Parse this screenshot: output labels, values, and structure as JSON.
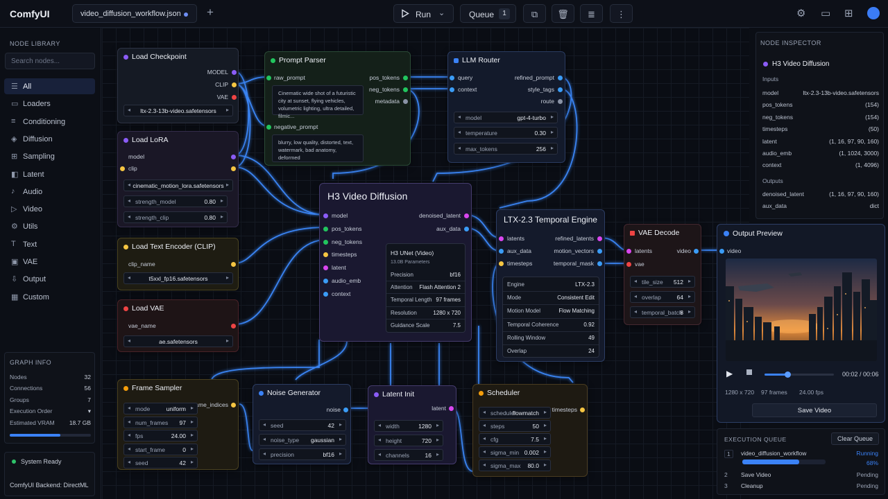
{
  "app": {
    "name": "ComfyUI",
    "file_tab": "video_diffusion_workflow.json"
  },
  "toolbar": {
    "run_label": "Run",
    "queue_label": "Queue",
    "queue_count": "1"
  },
  "sidebar": {
    "heading": "NODE LIBRARY",
    "search_placeholder": "Search nodes...",
    "categories": [
      "All",
      "Loaders",
      "Conditioning",
      "Diffusion",
      "Sampling",
      "Latent",
      "Audio",
      "Video",
      "Utils",
      "Text",
      "VAE",
      "Output",
      "Custom"
    ],
    "graph_info": {
      "heading": "GRAPH INFO",
      "rows": [
        {
          "k": "Nodes",
          "v": "32"
        },
        {
          "k": "Connections",
          "v": "56"
        },
        {
          "k": "Groups",
          "v": "7"
        },
        {
          "k": "Execution Order",
          "v": "▾"
        },
        {
          "k": "Estimated VRAM",
          "v": "18.7 GB"
        }
      ],
      "vram_fraction": 0.62
    },
    "status": "System Ready",
    "backend": "ComfyUI Backend: DirectML"
  },
  "nodes": {
    "load_checkpoint": {
      "title": "Load Checkpoint",
      "outputs": [
        "MODEL",
        "CLIP",
        "VAE"
      ],
      "file": "ltx-2.3-13b-video.safetensors"
    },
    "prompt_parser": {
      "title": "Prompt Parser",
      "raw_label": "raw_prompt",
      "raw_text": "Cinematic wide shot of a futuristic city at sunset, flying vehicles, volumetric lighting, ultra detailed, filmic...",
      "neg_label": "negative_prompt",
      "neg_text": "blurry, low quality, distorted, text, watermark, bad anatomy, deformed",
      "outputs": [
        "pos_tokens",
        "neg_tokens",
        "metadata"
      ]
    },
    "llm_router": {
      "title": "LLM Router",
      "inputs": [
        "query",
        "context"
      ],
      "outputs": [
        "refined_prompt",
        "style_tags",
        "route"
      ],
      "fields": [
        {
          "k": "model",
          "v": "gpt-4-turbo"
        },
        {
          "k": "temperature",
          "v": "0.30"
        },
        {
          "k": "max_tokens",
          "v": "256"
        }
      ]
    },
    "load_lora": {
      "title": "Load LoRA",
      "inputs": [
        "model",
        "clip"
      ],
      "file": "cinematic_motion_lora.safetensors",
      "fields": [
        {
          "k": "strength_model",
          "v": "0.80"
        },
        {
          "k": "strength_clip",
          "v": "0.80"
        }
      ]
    },
    "load_text_encoder": {
      "title": "Load Text Encoder (CLIP)",
      "field_label": "clip_name",
      "file": "t5xxl_fp16.safetensors"
    },
    "load_vae": {
      "title": "Load VAE",
      "field_label": "vae_name",
      "file": "ae.safetensors"
    },
    "h3": {
      "title": "H3 Video Diffusion",
      "inputs": [
        "model",
        "pos_tokens",
        "neg_tokens",
        "timesteps",
        "latent",
        "audio_emb",
        "context"
      ],
      "outputs": [
        "denoised_latent",
        "aux_data"
      ],
      "panel_title": "H3 UNet (Video)",
      "panel_sub": "13.0B Parameters",
      "rows": [
        {
          "k": "Precision",
          "v": "bf16"
        },
        {
          "k": "Attention",
          "v": "Flash Attention 2"
        },
        {
          "k": "Temporal Length",
          "v": "97 frames"
        },
        {
          "k": "Resolution",
          "v": "1280 x 720"
        },
        {
          "k": "Guidance Scale",
          "v": "7.5"
        }
      ]
    },
    "ltx": {
      "title": "LTX-2.3 Temporal Engine",
      "inputs": [
        "latents",
        "aux_data",
        "timesteps"
      ],
      "outputs": [
        "refined_latents",
        "motion_vectors",
        "temporal_mask"
      ],
      "rows": [
        {
          "k": "Engine",
          "v": "LTX-2.3"
        },
        {
          "k": "Mode",
          "v": "Consistent Edit"
        },
        {
          "k": "Motion Model",
          "v": "Flow Matching"
        },
        {
          "k": "Temporal Coherence",
          "v": "0.92"
        },
        {
          "k": "Rolling Window",
          "v": "49"
        },
        {
          "k": "Overlap",
          "v": "24"
        }
      ]
    },
    "vae_decode": {
      "title": "VAE Decode",
      "inputs": [
        "latents",
        "vae"
      ],
      "output": "video",
      "fields": [
        {
          "k": "tile_size",
          "v": "512"
        },
        {
          "k": "overlap",
          "v": "64"
        },
        {
          "k": "temporal_batch",
          "v": "8"
        }
      ]
    },
    "frame_sampler": {
      "title": "Frame Sampler",
      "output": "frame_indices",
      "fields": [
        {
          "k": "mode",
          "v": "uniform"
        },
        {
          "k": "num_frames",
          "v": "97"
        },
        {
          "k": "fps",
          "v": "24.00"
        },
        {
          "k": "start_frame",
          "v": "0"
        },
        {
          "k": "seed",
          "v": "42"
        }
      ]
    },
    "noise_generator": {
      "title": "Noise Generator",
      "output": "noise",
      "fields": [
        {
          "k": "seed",
          "v": "42"
        },
        {
          "k": "noise_type",
          "v": "gaussian"
        },
        {
          "k": "precision",
          "v": "bf16"
        }
      ]
    },
    "latent_init": {
      "title": "Latent Init",
      "output": "latent",
      "fields": [
        {
          "k": "width",
          "v": "1280"
        },
        {
          "k": "height",
          "v": "720"
        },
        {
          "k": "channels",
          "v": "16"
        }
      ]
    },
    "scheduler": {
      "title": "Scheduler",
      "output": "timesteps",
      "fields": [
        {
          "k": "scheduler",
          "v": "flowmatch"
        },
        {
          "k": "steps",
          "v": "50"
        },
        {
          "k": "cfg",
          "v": "7.5"
        },
        {
          "k": "sigma_min",
          "v": "0.002"
        },
        {
          "k": "sigma_max",
          "v": "80.0"
        }
      ]
    }
  },
  "inspector": {
    "heading": "NODE INSPECTOR",
    "node": "H3 Video Diffusion",
    "inputs_label": "Inputs",
    "inputs": [
      {
        "k": "model",
        "v": "ltx-2.3-13b-video.safetensors"
      },
      {
        "k": "pos_tokens",
        "v": "(154)"
      },
      {
        "k": "neg_tokens",
        "v": "(154)"
      },
      {
        "k": "timesteps",
        "v": "(50)"
      },
      {
        "k": "latent",
        "v": "(1, 16, 97, 90, 160)"
      },
      {
        "k": "audio_emb",
        "v": "(1, 1024, 3000)"
      },
      {
        "k": "context",
        "v": "(1, 4096)"
      }
    ],
    "outputs_label": "Outputs",
    "outputs": [
      {
        "k": "denoised_latent",
        "v": "(1, 16, 97, 90, 160)"
      },
      {
        "k": "aux_data",
        "v": "dict"
      }
    ]
  },
  "preview": {
    "title": "Output Preview",
    "input": "video",
    "time": "00:02 / 00:06",
    "progress": 0.33,
    "resolution": "1280 x 720",
    "frames": "97 frames",
    "fps": "24.00 fps",
    "save_label": "Save Video"
  },
  "queue": {
    "heading": "EXECUTION QUEUE",
    "clear_label": "Clear Queue",
    "items": [
      {
        "n": "1",
        "name": "video_diffusion_workflow",
        "status": "Running",
        "pct": "68%",
        "progress": 0.68
      },
      {
        "n": "2",
        "name": "Save Video",
        "status": "Pending"
      },
      {
        "n": "3",
        "name": "Cleanup",
        "status": "Pending"
      }
    ]
  },
  "colors": {
    "accent": "#3b82f6",
    "wire": "#3d8bff",
    "model_pin": "#8b5cf6",
    "clip_pin": "#f5c542",
    "vae_pin": "#ef4444",
    "token_pin": "#22c55e",
    "latent_pin": "#d946ef",
    "data_pin": "#3b9cf6",
    "timesteps_pin": "#f59e0b"
  }
}
